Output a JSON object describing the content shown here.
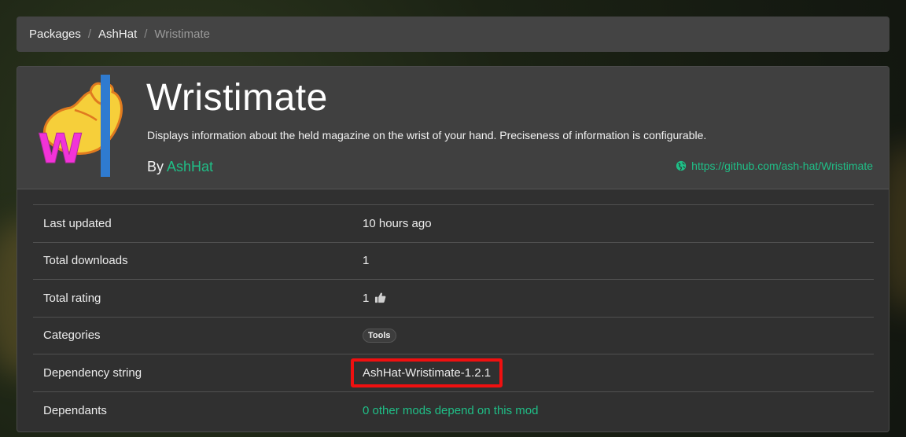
{
  "breadcrumb": {
    "items": [
      "Packages",
      "AshHat",
      "Wristimate"
    ],
    "separator": "/"
  },
  "package": {
    "title": "Wristimate",
    "description": "Displays information about the held magazine on the wrist of your hand. Preciseness of information is configurable.",
    "by_label": "By",
    "author": "AshHat",
    "repo_url": "https://github.com/ash-hat/Wristimate",
    "logo_letter": "W"
  },
  "details": {
    "last_updated_label": "Last updated",
    "last_updated_value": "10 hours ago",
    "total_downloads_label": "Total downloads",
    "total_downloads_value": "1",
    "total_rating_label": "Total rating",
    "total_rating_value": "1",
    "categories_label": "Categories",
    "categories": [
      "Tools"
    ],
    "dependency_label": "Dependency string",
    "dependency_value": "AshHat-Wristimate-1.2.1",
    "dependants_label": "Dependants",
    "dependants_value": "0 other mods depend on this mod"
  },
  "colors": {
    "accent": "#1fbf87",
    "highlight_box": "#f01010",
    "card_bg": "#303030",
    "header_bg": "#404040"
  },
  "icons": {
    "rating": "thumbs-up-icon",
    "repo": "globe-icon"
  }
}
